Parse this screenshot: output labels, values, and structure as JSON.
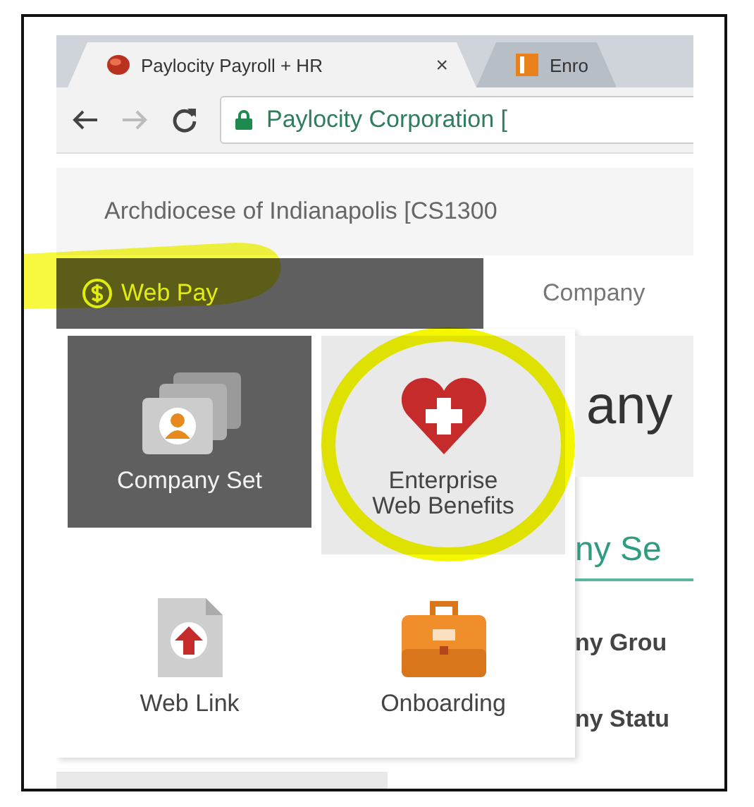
{
  "browser": {
    "tabs": [
      {
        "title": "Paylocity Payroll + HR",
        "close": "×",
        "selected": true
      },
      {
        "title": "Enro",
        "selected": false
      }
    ],
    "address": {
      "site": "Paylocity Corporation ["
    }
  },
  "company_header": "Archdiocese of Indianapolis [CS1300",
  "nav": {
    "product": "Web Pay",
    "tab": "Company"
  },
  "menu": {
    "tiles": [
      {
        "label": "Company Set",
        "kind": "cards",
        "selected": true,
        "hovered": false
      },
      {
        "label": "Enterprise Web Benefits",
        "kind": "heart",
        "selected": false,
        "hovered": true
      },
      {
        "label": "Web Link",
        "kind": "link",
        "selected": false,
        "hovered": false
      },
      {
        "label": "Onboarding",
        "kind": "briefcase",
        "selected": false,
        "hovered": false
      }
    ]
  },
  "content": {
    "title": "any",
    "section": "ny Se",
    "fields": [
      "ny Grou",
      "ny Statu"
    ]
  },
  "annotations": {
    "highlight": true,
    "circle": true
  }
}
